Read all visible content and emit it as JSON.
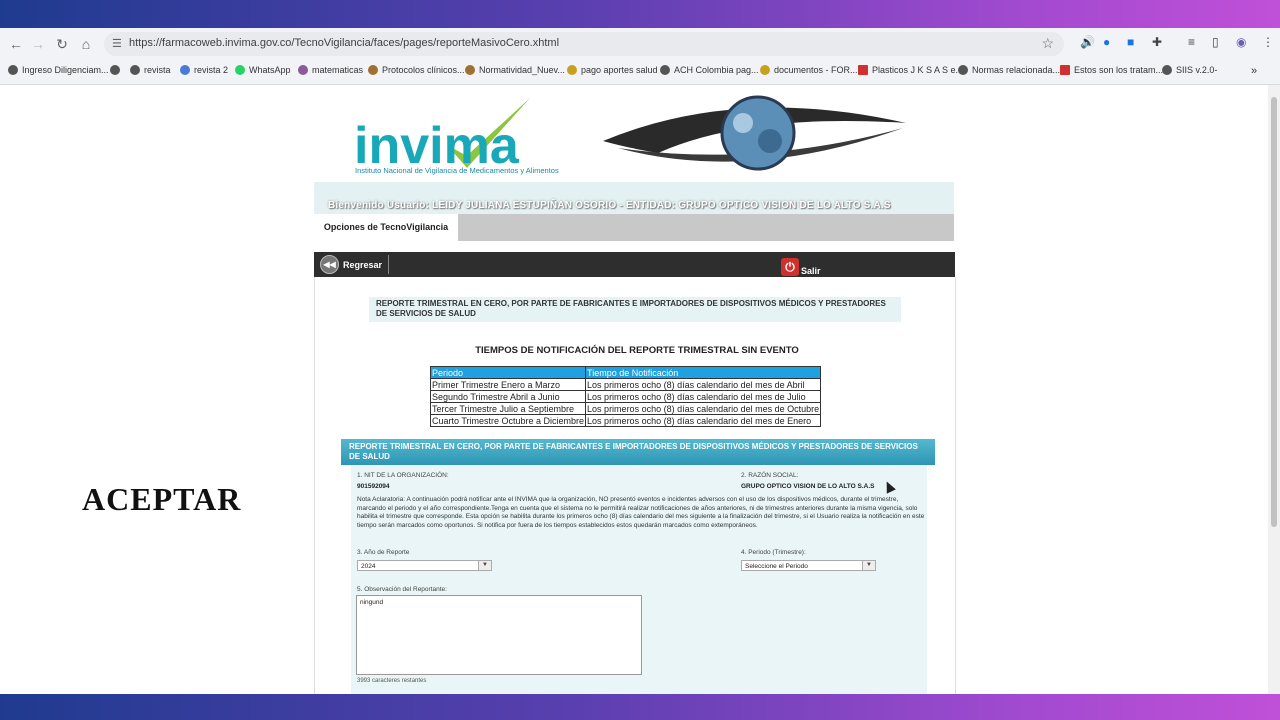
{
  "browser": {
    "url": "https://farmacoweb.invima.gov.co/TecnoVigilancia/faces/pages/reporteMasivoCero.xhtml",
    "bookmarks": [
      "Ingreso Diligenciam...",
      "revista",
      "revista 2",
      "WhatsApp",
      "matematicas",
      "Protocolos clínicos...",
      "Normatividad_Nuev...",
      "pago aportes salud",
      "ACH Colombia pag...",
      "documentos - FOR...",
      "Plasticos J K S A S e...",
      "Normas relacionada...",
      "Estos son los tratam...",
      "SIIS v.2.0-"
    ]
  },
  "logo": {
    "name": "invima",
    "subtitle": "Instituto Nacional de Vigilancia de Medicamentos y Alimentos"
  },
  "header": {
    "welcome": "Bienvenido Usuario: LEIDY JULIANA ESTUPIÑAN OSORIO - ENTIDAD: GRUPO OPTICO VISION DE LO ALTO S.A.S",
    "menu_tab": "Opciones de TecnoVigilancia"
  },
  "toolbar": {
    "back_label": "Regresar",
    "exit_label": "Salir"
  },
  "report": {
    "title": "REPORTE TRIMESTRAL EN CERO, POR PARTE DE FABRICANTES E IMPORTADORES DE DISPOSITIVOS MÉDICOS Y PRESTADORES DE SERVICIOS DE SALUD",
    "times_title": "TIEMPOS DE NOTIFICACIÓN DEL REPORTE TRIMESTRAL SIN EVENTO",
    "table_headers": [
      "Periodo",
      "Tiempo de Notificación"
    ],
    "table_rows": [
      [
        "Primer Trimestre Enero a Marzo",
        "Los primeros ocho (8) días calendario del mes de Abril"
      ],
      [
        "Segundo Trimestre Abril a Junio",
        "Los primeros ocho (8) días calendario del mes de Julio"
      ],
      [
        "Tercer Trimestre Julio a Septiembre",
        "Los primeros ocho (8) días calendario del mes de Octubre"
      ],
      [
        "Cuarto Trimestre Octubre a Diciembre",
        "Los primeros ocho (8) días calendario del mes de Enero"
      ]
    ]
  },
  "form": {
    "header": "REPORTE TRIMESTRAL EN CERO, POR PARTE DE FABRICANTES E IMPORTADORES DE DISPOSITIVOS MÉDICOS Y PRESTADORES DE SERVICIOS DE SALUD",
    "nit_label": "1. NIT DE LA ORGANIZACIÓN:",
    "nit_value": "901592094",
    "razon_label": "2. RAZÓN SOCIAL:",
    "razon_value": "GRUPO OPTICO VISION DE LO ALTO S.A.S",
    "nota": "Nota Aclaratoria: A continuación podrá notificar ante el INVIMA que la organización, NO presentó eventos e incidentes adversos con el uso de los dispositivos médicos, durante el trimestre, marcando el periodo y el año correspondiente.Tenga en cuenta que el sistema no le permitirá realizar notificaciones de años anteriores, ni de trimestres anteriores durante la misma vigencia, solo habilita el trimestre que corresponde. Esta opción se habilita durante los primeros ocho (8) días calendario del mes siguiente a la finalización del trimestre, si el Usuario realiza la notificación en este tiempo serán marcados como oportunos. Si notifica por fuera de los tiempos establecidos estos quedarán marcados como extemporáneos.",
    "year_label": "3. Año de Reporte",
    "year_value": "2024",
    "period_label": "4. Periodo (Trimestre):",
    "period_value": "Seleccione el Periodo",
    "obs_label": "5. Observación del Reportante:",
    "obs_value": "ningund",
    "counter": "3993 caracteres restantes"
  },
  "overlay": {
    "aceptar": "ACEPTAR"
  }
}
